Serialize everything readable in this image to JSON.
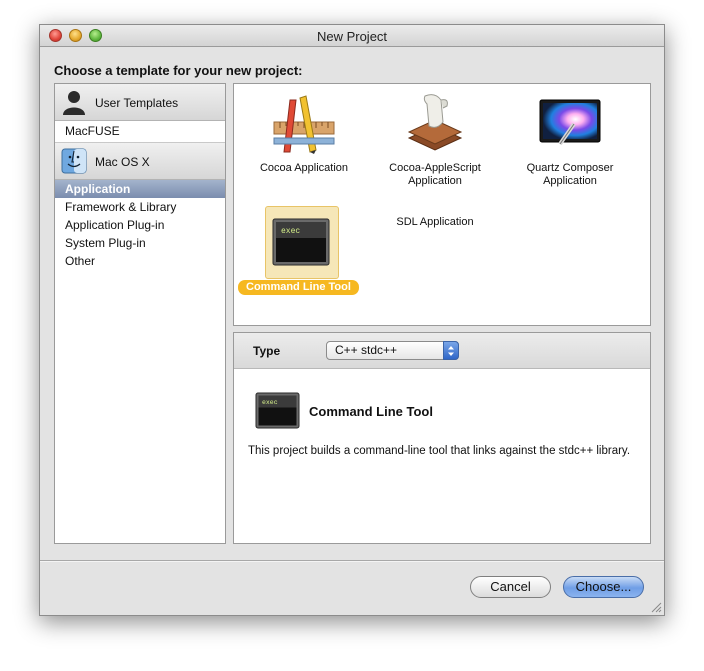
{
  "window": {
    "title": "New Project"
  },
  "heading": "Choose a template for your new project:",
  "sidebar": {
    "groups": [
      {
        "label": "User Templates",
        "icon": "user-silhouette-icon",
        "items": [
          {
            "label": "MacFUSE",
            "selected": false
          }
        ]
      },
      {
        "label": "Mac OS X",
        "icon": "finder-icon",
        "items": [
          {
            "label": "Application",
            "selected": true
          },
          {
            "label": "Framework & Library",
            "selected": false
          },
          {
            "label": "Application Plug-in",
            "selected": false
          },
          {
            "label": "System Plug-in",
            "selected": false
          },
          {
            "label": "Other",
            "selected": false
          }
        ]
      }
    ]
  },
  "templates": [
    {
      "label": "Cocoa Application",
      "icon": "pencil-ruler-icon",
      "selected": false
    },
    {
      "label": "Cocoa-AppleScript Application",
      "icon": "script-scroll-icon",
      "selected": false
    },
    {
      "label": "Quartz Composer Application",
      "icon": "quartz-composer-icon",
      "selected": false
    },
    {
      "label": "Command Line Tool",
      "icon": "terminal-exec-icon",
      "selected": true
    },
    {
      "label": "SDL Application",
      "icon": "",
      "selected": false
    }
  ],
  "detail": {
    "type_label": "Type",
    "type_value": "C++ stdc++",
    "icon_text": "exec",
    "name": "Command Line Tool",
    "description": "This project builds a command-line tool that links against the stdc++ library."
  },
  "buttons": {
    "cancel": "Cancel",
    "choose": "Choose..."
  },
  "colors": {
    "selection": "#8093b4",
    "highlight": "#f6b821",
    "default_button": "#6f9ee6"
  }
}
